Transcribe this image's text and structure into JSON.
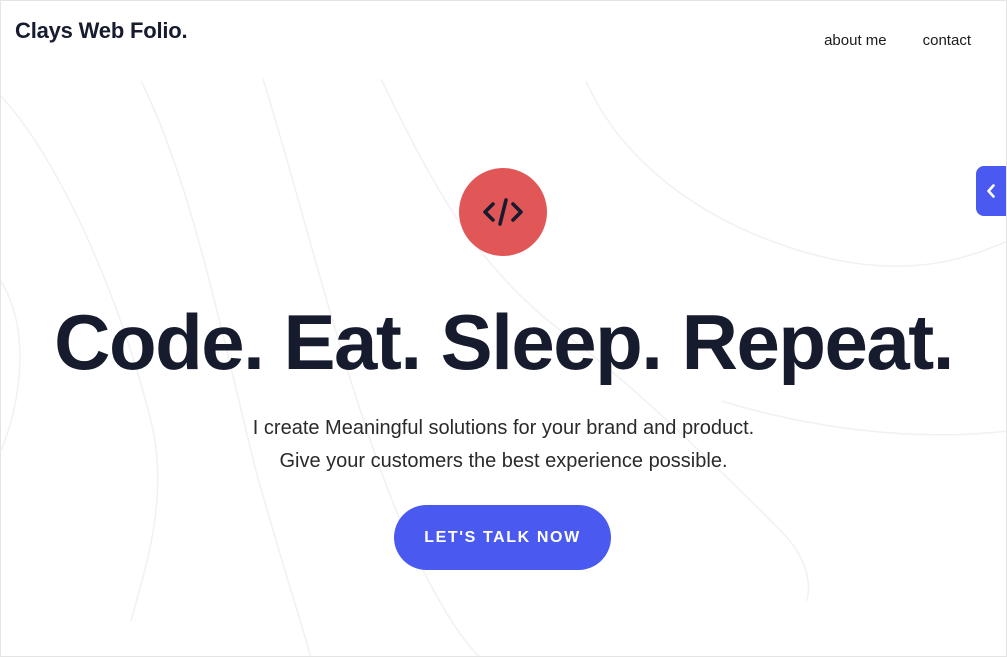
{
  "header": {
    "brand": "Clays Web Folio.",
    "nav": [
      "about me",
      "contact"
    ]
  },
  "hero": {
    "icon": "code-icon",
    "headline": "Code. Eat. Sleep. Repeat.",
    "subtext_line1": "I create Meaningful solutions for your brand and product.",
    "subtext_line2": "Give your customers the best experience possible.",
    "cta_label": "LET'S TALK NOW"
  },
  "side_tab": {
    "icon": "chevron-left-icon"
  },
  "colors": {
    "accent": "#4a5af0",
    "icon_bg": "#e15656",
    "text_dark": "#161b2e"
  }
}
